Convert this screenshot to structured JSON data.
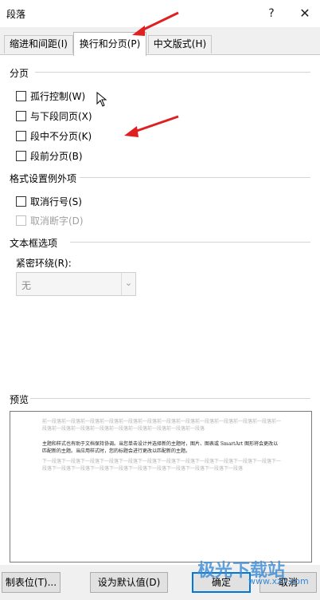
{
  "dialog": {
    "title": "段落",
    "help": "?",
    "close": "✕"
  },
  "tabs": [
    {
      "label": "缩进和间距(I)"
    },
    {
      "label": "换行和分页(P)"
    },
    {
      "label": "中文版式(H)"
    }
  ],
  "pagination": {
    "heading": "分页",
    "options": [
      {
        "label": "孤行控制(W)"
      },
      {
        "label": "与下段同页(X)"
      },
      {
        "label": "段中不分页(K)"
      },
      {
        "label": "段前分页(B)"
      }
    ]
  },
  "exceptions": {
    "heading": "格式设置例外项",
    "options": [
      {
        "label": "取消行号(S)"
      },
      {
        "label": "取消断字(D)"
      }
    ]
  },
  "textbox": {
    "heading": "文本框选项",
    "wrap_label": "紧密环绕(R):",
    "wrap_value": "无"
  },
  "preview": {
    "label": "预览",
    "before": "前一段落前一段落前一段落前一段落前一段落前一段落前一段落前一段落前一段落前一段落前一段落前一段落前一段落前一段落前一段落前一段落前一段落前一段落前一段落前一段落前一段落",
    "main": "主题和样式也有助于文档保持协调。当您单击设计并选择新的主题时，图片、图表或 SmartArt 图形将会更改以匹配新的主题。当应用样式时，您的标题会进行更改以匹配新的主题。",
    "after": "下一段落下一段落下一段落下一段落下一段落下一段落下一段落下一段落下一段落下一段落下一段落下一段落下一段落下一段落下一段落下一段落下一段落下一段落下一段落下一段落下一段落下一段落下一段落"
  },
  "footer": {
    "tabs_button": "制表位(T)...",
    "default_button": "设为默认值(D)",
    "ok_button": "确定",
    "cancel_button": "取消"
  },
  "watermark": {
    "text": "极光下载站",
    "url": "www.xz7.com"
  },
  "colors": {
    "accent": "#0078d7",
    "arrow": "#e02020"
  }
}
